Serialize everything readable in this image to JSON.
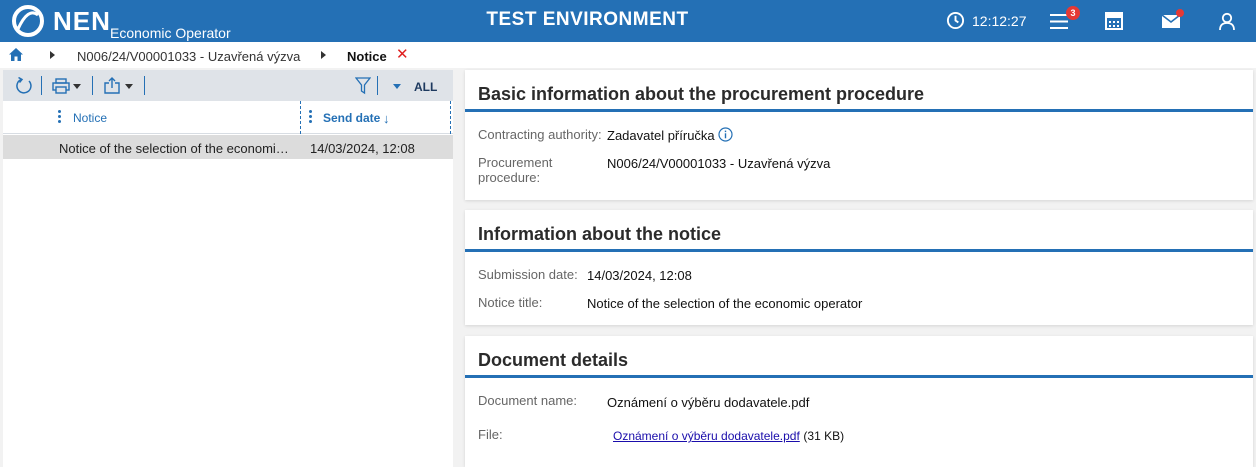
{
  "header": {
    "brand": "NEN",
    "brand_sub": "Economic Operator",
    "environment": "TEST ENVIRONMENT",
    "clock": "12:12:27",
    "notifications_count": "3",
    "brand_color": "#2470b5"
  },
  "breadcrumb": {
    "items": [
      "N006/24/V00001033 - Uzavřená výzva",
      "Notice"
    ],
    "close_symbol": "✕"
  },
  "toolbar": {
    "filter_all": "ALL",
    "icons": [
      "refresh-icon",
      "print-icon",
      "export-icon",
      "filter-icon"
    ]
  },
  "grid": {
    "columns": [
      "Notice",
      "Send date"
    ],
    "sort_indicator": "↓",
    "rows": [
      {
        "notice": "Notice of the selection of the economic operator",
        "send_date": "14/03/2024, 12:08"
      }
    ]
  },
  "basic_info": {
    "title": "Basic information about the procurement procedure",
    "contracting_authority_label": "Contracting authority:",
    "contracting_authority": "Zadavatel příručka",
    "procedure_label_1": "Procurement",
    "procedure_label_2": "procedure:",
    "procedure": "N006/24/V00001033 - Uzavřená výzva"
  },
  "notice_info": {
    "title": "Information about the notice",
    "submission_label": "Submission date:",
    "submission_date": "14/03/2024, 12:08",
    "notice_title_label": "Notice title:",
    "notice_title": "Notice of the selection of the economic operator"
  },
  "document": {
    "title": "Document details",
    "name_label": "Document name:",
    "name": "Oznámení o výběru dodavatele.pdf",
    "file_label": "File:",
    "file_link": "Oznámení o výběru dodavatele.pdf",
    "file_size": "(31 KB)"
  }
}
